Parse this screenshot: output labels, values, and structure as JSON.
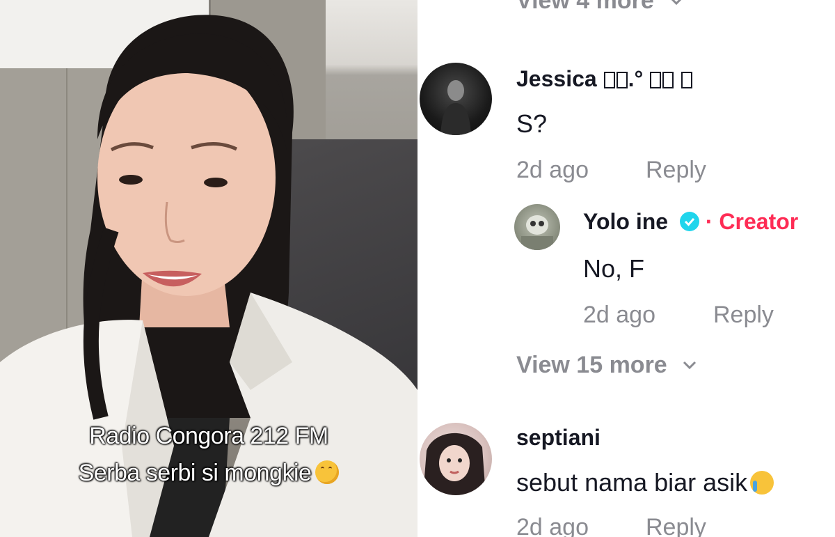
{
  "video": {
    "caption_line1": "Radio Congora 212 FM",
    "caption_line2": "Serba serbi si mongkie",
    "caption_emoji": "hand-over-mouth-emoji"
  },
  "comments": {
    "top_view_more": "View 4 more",
    "items": [
      {
        "username": "Jessica",
        "username_suffix": "□□.° □□ □",
        "text": "S?",
        "time": "2d ago",
        "reply_label": "Reply",
        "replies": [
          {
            "username": "Yolo ine",
            "verified_icon": "verified-badge-icon",
            "role": "· Creator",
            "text": "No, F",
            "time": "2d ago",
            "reply_label": "Reply"
          }
        ],
        "view_more": "View 15 more"
      },
      {
        "username": "septiani",
        "text": "sebut nama biar asik",
        "text_emoji": "crying-face-emoji",
        "time": "2d ago",
        "reply_label": "Reply"
      }
    ]
  },
  "colors": {
    "text_primary": "#161823",
    "text_muted": "#8a8b91",
    "creator": "#fe2c55",
    "verified": "#20d5ec"
  }
}
